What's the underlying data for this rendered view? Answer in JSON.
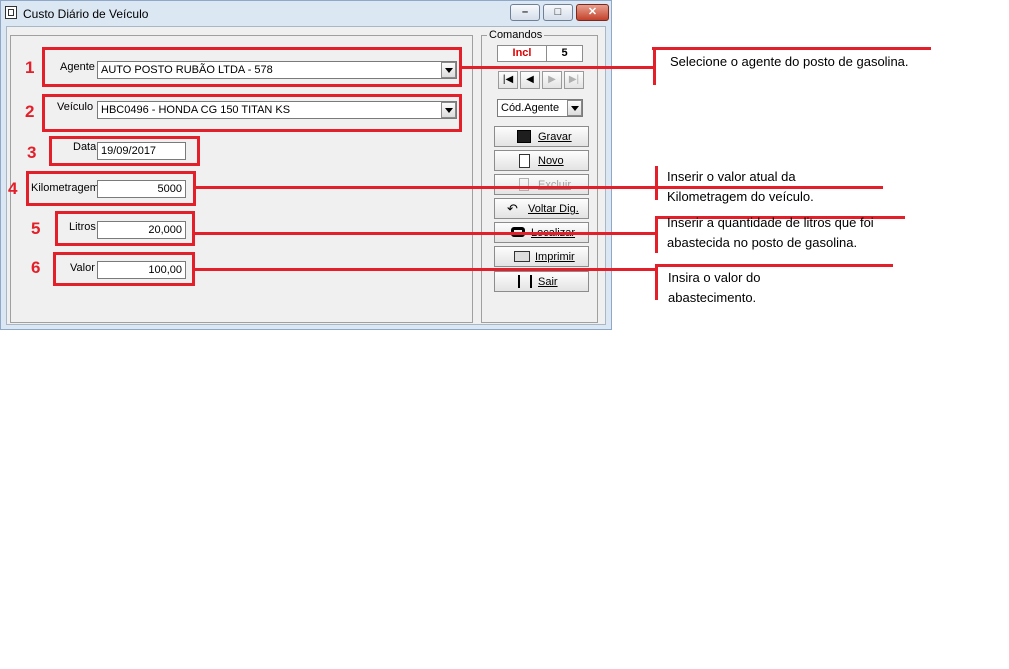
{
  "window": {
    "title": "Custo Diário de Veículo",
    "minimize_glyph": "–",
    "maximize_glyph": "□",
    "close_glyph": "✕"
  },
  "form": {
    "agente": {
      "label": "Agente",
      "value": "AUTO POSTO RUBÃO LTDA - 578"
    },
    "veiculo": {
      "label": "Veículo",
      "value": "HBC0496 - HONDA CG 150 TITAN KS"
    },
    "data": {
      "label": "Data",
      "value": "19/09/2017"
    },
    "kilometragem": {
      "label": "Kilometragem",
      "value": "5000"
    },
    "litros": {
      "label": "Litros",
      "value": "20,000"
    },
    "valor": {
      "label": "Valor",
      "value": "100,00"
    }
  },
  "comandos": {
    "legend": "Comandos",
    "mode": "Incl",
    "count": "5",
    "nav": [
      "|◀",
      "◀",
      "▶",
      "▶|"
    ],
    "order_select": "Cód.Agente",
    "buttons": {
      "gravar": "Gravar",
      "novo": "Novo",
      "excluir": "Excluir",
      "voltar": "Voltar Dig.",
      "localizar": "Localizar",
      "imprimir": "Imprimir",
      "sair": "Sair"
    }
  },
  "annotations": {
    "numbers": [
      "1",
      "2",
      "3",
      "4",
      "5",
      "6"
    ],
    "notes": [
      "Selecione o agente do posto de gasolina.",
      "Inserir o valor atual da",
      "Kilometragem do veículo.",
      "Inserir a quantidade de litros que foi",
      "abastecida no posto de gasolina.",
      "Insira o valor do",
      "abastecimento."
    ]
  },
  "colors": {
    "annotation_red": "#e3202a",
    "mode_text_red": "#e00000"
  }
}
